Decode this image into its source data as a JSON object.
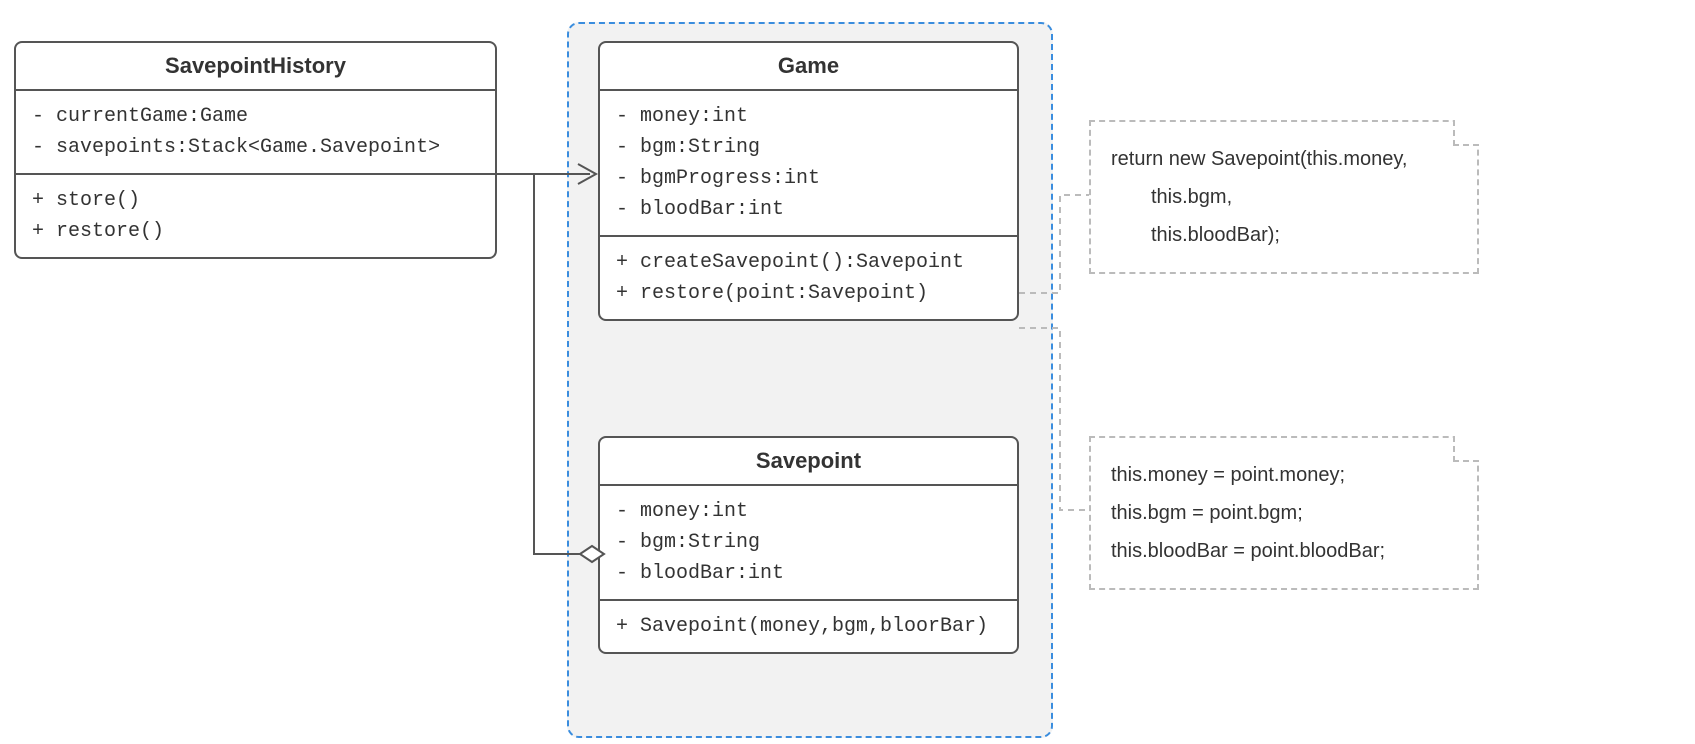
{
  "classes": {
    "savepointHistory": {
      "name": "SavepointHistory",
      "attrs": [
        "- currentGame:Game",
        "- savepoints:Stack<Game.Savepoint>"
      ],
      "ops": [
        "+ store()",
        "+ restore()"
      ]
    },
    "game": {
      "name": "Game",
      "attrs": [
        "- money:int",
        "- bgm:String",
        "- bgmProgress:int",
        "- bloodBar:int"
      ],
      "ops": [
        "+ createSavepoint():Savepoint",
        "+ restore(point:Savepoint)"
      ]
    },
    "savepoint": {
      "name": "Savepoint",
      "attrs": [
        "- money:int",
        "- bgm:String",
        "- bloodBar:int"
      ],
      "ops": [
        "+ Savepoint(money,bgm,bloorBar)"
      ]
    }
  },
  "notes": {
    "n1": {
      "lines": [
        "return new Savepoint(this.money,",
        "  this.bgm,",
        "  this.bloodBar);"
      ]
    },
    "n2": {
      "lines": [
        "this.money = point.money;",
        "this.bgm = point.bgm;",
        "this.bloodBar = point.bloodBar;"
      ]
    }
  }
}
